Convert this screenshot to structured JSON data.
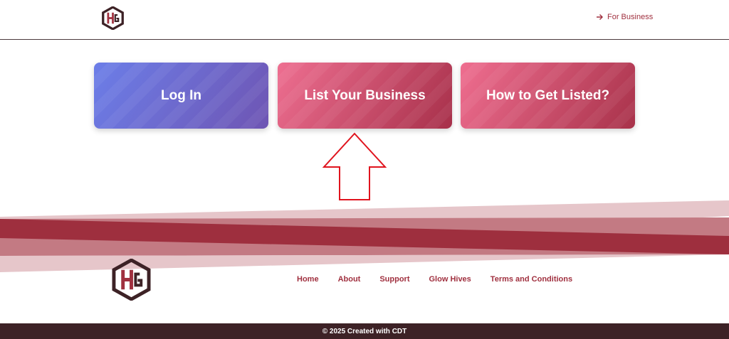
{
  "header": {
    "for_business_label": "For Business"
  },
  "cards": {
    "login_label": "Log In",
    "list_business_label": "List Your Business",
    "how_to_label": "How to Get Listed?"
  },
  "footer": {
    "nav": [
      "Home",
      "About",
      "Support",
      "Glow Hives",
      "Terms and Conditions"
    ],
    "copyright": "© 2025 Created with CDT"
  },
  "icons": {
    "logo": "hexagon-hg-logo",
    "for_business": "arrow-right-icon",
    "annotation": "up-arrow-outline-icon"
  },
  "colors": {
    "brand": "#a0303f",
    "dark": "#3d2226",
    "login_gradient": [
      "#6c7ee8",
      "#6e55b3"
    ],
    "pink_gradient": [
      "#ee6f91",
      "#a7304a"
    ],
    "annotation": "#e0141e"
  }
}
